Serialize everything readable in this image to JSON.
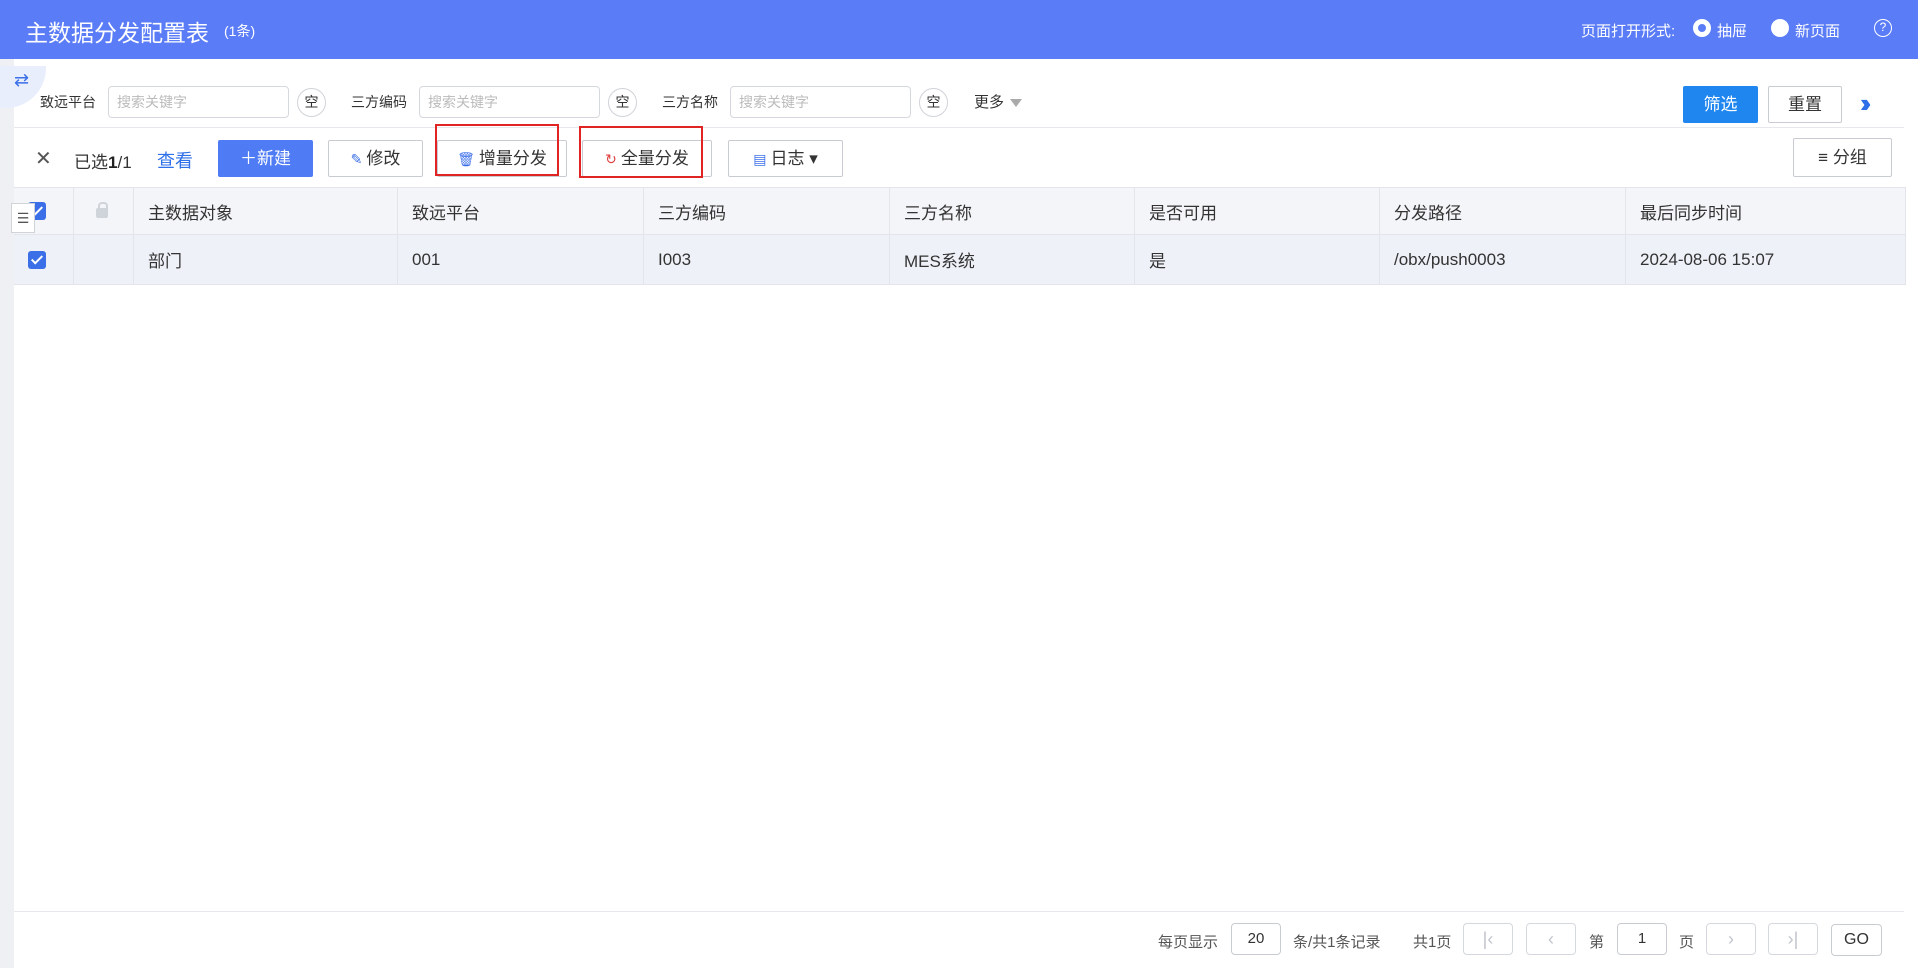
{
  "header": {
    "title": "主数据分发配置表",
    "count": "(1条)",
    "mode_label": "页面打开形式:",
    "mode_options": [
      {
        "label": "抽屉",
        "checked": true
      },
      {
        "label": "新页面",
        "checked": false
      }
    ],
    "help": "?"
  },
  "filters": [
    {
      "label": "致远平台",
      "placeholder": "搜索关键字",
      "empty": "空"
    },
    {
      "label": "三方编码",
      "placeholder": "搜索关键字",
      "empty": "空"
    },
    {
      "label": "三方名称",
      "placeholder": "搜索关键字",
      "empty": "空"
    }
  ],
  "more_label": "更多",
  "filter_button": "筛选",
  "reset_button": "重置",
  "toolbar": {
    "selected_prefix": "已选",
    "selected_count": "1",
    "selected_total": "/1",
    "view": "查看",
    "new": "新建",
    "edit": "修改",
    "incremental": "增量分发",
    "full": "全量分发",
    "log": "日志",
    "group": "分组"
  },
  "table": {
    "columns": [
      "主数据对象",
      "致远平台",
      "三方编码",
      "三方名称",
      "是否可用",
      "分发路径",
      "最后同步时间"
    ],
    "rows": [
      [
        "部门",
        "001",
        "I003",
        "MES系统",
        "是",
        "/obx/push0003",
        "2024-08-06 15:07"
      ]
    ]
  },
  "footer": {
    "per_page_label": "每页显示",
    "per_page": "20",
    "records": "条/共1条记录",
    "total_pages": "共1页",
    "page_prefix": "第",
    "page": "1",
    "page_suffix": "页",
    "go": "GO"
  },
  "colors": {
    "header": "#5b7cf7",
    "primary": "#1f86f0",
    "highlight": "#e02424"
  }
}
